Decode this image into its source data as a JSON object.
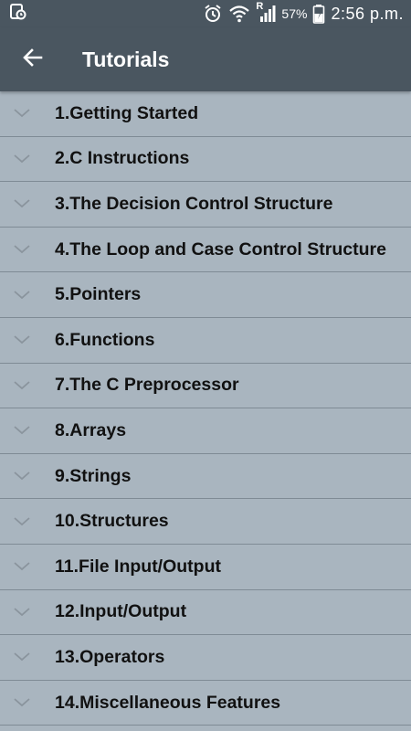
{
  "status_bar": {
    "battery_percent": "57%",
    "time": "2:56 p.m.",
    "signal_label": "R"
  },
  "app_bar": {
    "title": "Tutorials"
  },
  "tutorials": [
    "1.Getting Started",
    "2.C Instructions",
    "3.The Decision Control Structure",
    "4.The Loop and Case Control Structure",
    "5.Pointers",
    "6.Functions",
    "7.The C Preprocessor",
    "8.Arrays",
    "9.Strings",
    "10.Structures",
    "11.File Input/Output",
    "12.Input/Output",
    "13.Operators",
    "14.Miscellaneous Features"
  ],
  "colors": {
    "app_bar": "#4a5660",
    "list_background": "#a9b5bf",
    "divider": "#7f8b95",
    "text": "#111111"
  },
  "icons": {
    "back": "arrow-left-icon",
    "expand": "chevron-down-icon"
  }
}
